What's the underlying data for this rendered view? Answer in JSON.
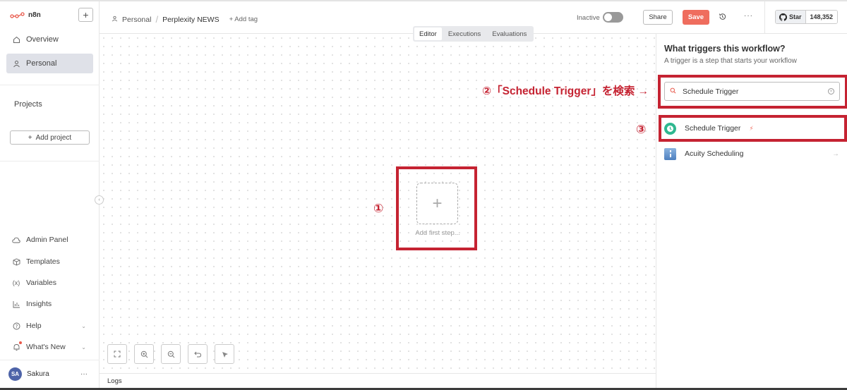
{
  "app": {
    "name": "n8n"
  },
  "sidebar": {
    "items": [
      {
        "label": "Overview",
        "icon": "home-icon"
      },
      {
        "label": "Personal",
        "icon": "user-icon"
      }
    ],
    "projects_label": "Projects",
    "add_project_label": "Add project",
    "bottom_items": [
      {
        "label": "Admin Panel",
        "icon": "cloud-icon"
      },
      {
        "label": "Templates",
        "icon": "box-icon"
      },
      {
        "label": "Variables",
        "icon": "variable-icon"
      },
      {
        "label": "Insights",
        "icon": "chart-icon"
      },
      {
        "label": "Help",
        "icon": "help-icon"
      },
      {
        "label": "What's New",
        "icon": "bell-icon"
      }
    ],
    "user": {
      "initials": "SA",
      "name": "Sakura"
    }
  },
  "header": {
    "breadcrumb_owner": "Personal",
    "breadcrumb_sep": "/",
    "workflow_name": "Perplexity NEWS",
    "add_tag": "+ Add tag",
    "status_label": "Inactive",
    "share_label": "Share",
    "save_label": "Save",
    "more_label": "···",
    "github": {
      "label": "Star",
      "count": "148,352"
    }
  },
  "tabs": [
    {
      "label": "Editor",
      "active": true
    },
    {
      "label": "Executions",
      "active": false
    },
    {
      "label": "Evaluations",
      "active": false
    }
  ],
  "canvas": {
    "add_step_icon": "+",
    "add_step_label": "Add first step...",
    "logs_label": "Logs"
  },
  "panel": {
    "title": "What triggers this workflow?",
    "subtitle": "A trigger is a step that starts your workflow",
    "search_value": "Schedule Trigger",
    "results": [
      {
        "label": "Schedule Trigger",
        "icon": "clock-icon"
      },
      {
        "label": "Acuity Scheduling",
        "icon": "acuity-icon"
      }
    ]
  },
  "annotations": {
    "step1": "①",
    "step2": "②「Schedule Trigger」を検索 →",
    "step3": "③"
  },
  "colors": {
    "accent": "#ef6d5e",
    "highlight": "#c52332",
    "clock": "#2fb890"
  }
}
